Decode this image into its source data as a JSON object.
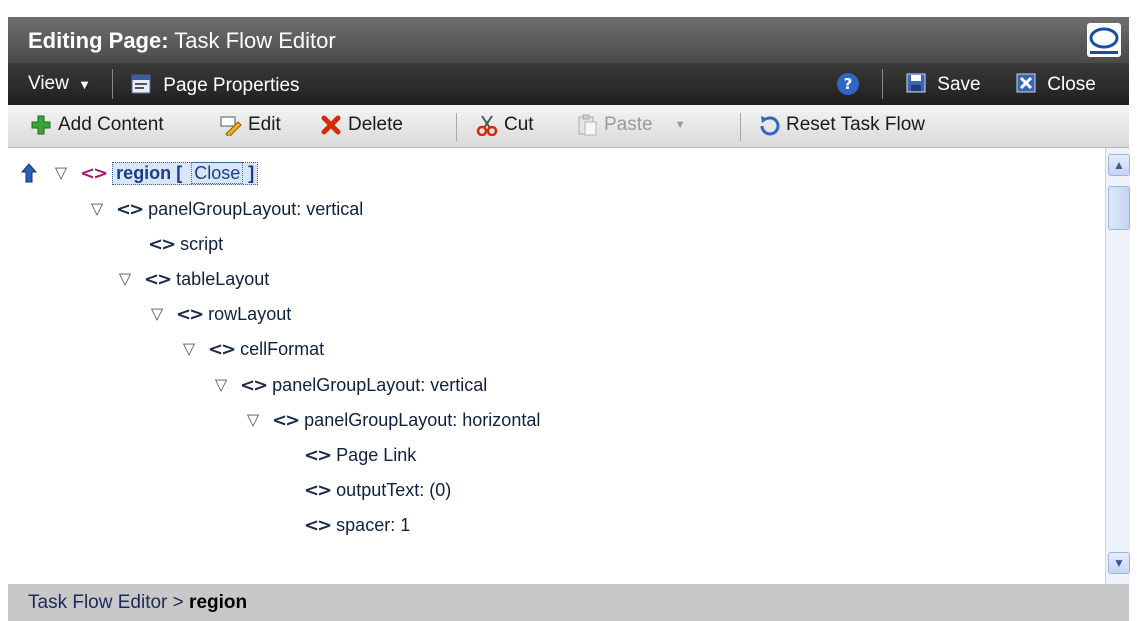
{
  "header": {
    "title_prefix": "Editing Page:",
    "title_page": "Task Flow Editor",
    "logo_icon": "oracle-logo-icon"
  },
  "menubar": {
    "view_label": "View",
    "page_properties_label": "Page Properties",
    "help_icon": "help-icon",
    "save_label": "Save",
    "close_label": "Close"
  },
  "toolbar": {
    "add_content_label": "Add Content",
    "edit_label": "Edit",
    "delete_label": "Delete",
    "cut_label": "Cut",
    "paste_label": "Paste",
    "reset_task_flow_label": "Reset Task Flow"
  },
  "tree": {
    "root": {
      "label": "region",
      "open_bracket": "[",
      "close_link": "Close",
      "close_bracket": "]"
    },
    "nodes": [
      {
        "label": "panelGroupLayout: vertical"
      },
      {
        "label": "script"
      },
      {
        "label": "tableLayout"
      },
      {
        "label": "rowLayout"
      },
      {
        "label": "cellFormat"
      },
      {
        "label": "panelGroupLayout: vertical"
      },
      {
        "label": "panelGroupLayout: horizontal"
      },
      {
        "label": "Page Link"
      },
      {
        "label": "outputText: (0)"
      },
      {
        "label": "spacer: 1"
      }
    ]
  },
  "breadcrumb": {
    "parent": "Task Flow Editor",
    "separator": ">",
    "current": "region"
  },
  "colors": {
    "title_bg": "#5a5a5a",
    "menubar_bg": "#2b2b2b",
    "toolbar_bg": "#e6e6e6",
    "selected_tag": "#b0127e",
    "link_blue": "#1c3c8c"
  }
}
